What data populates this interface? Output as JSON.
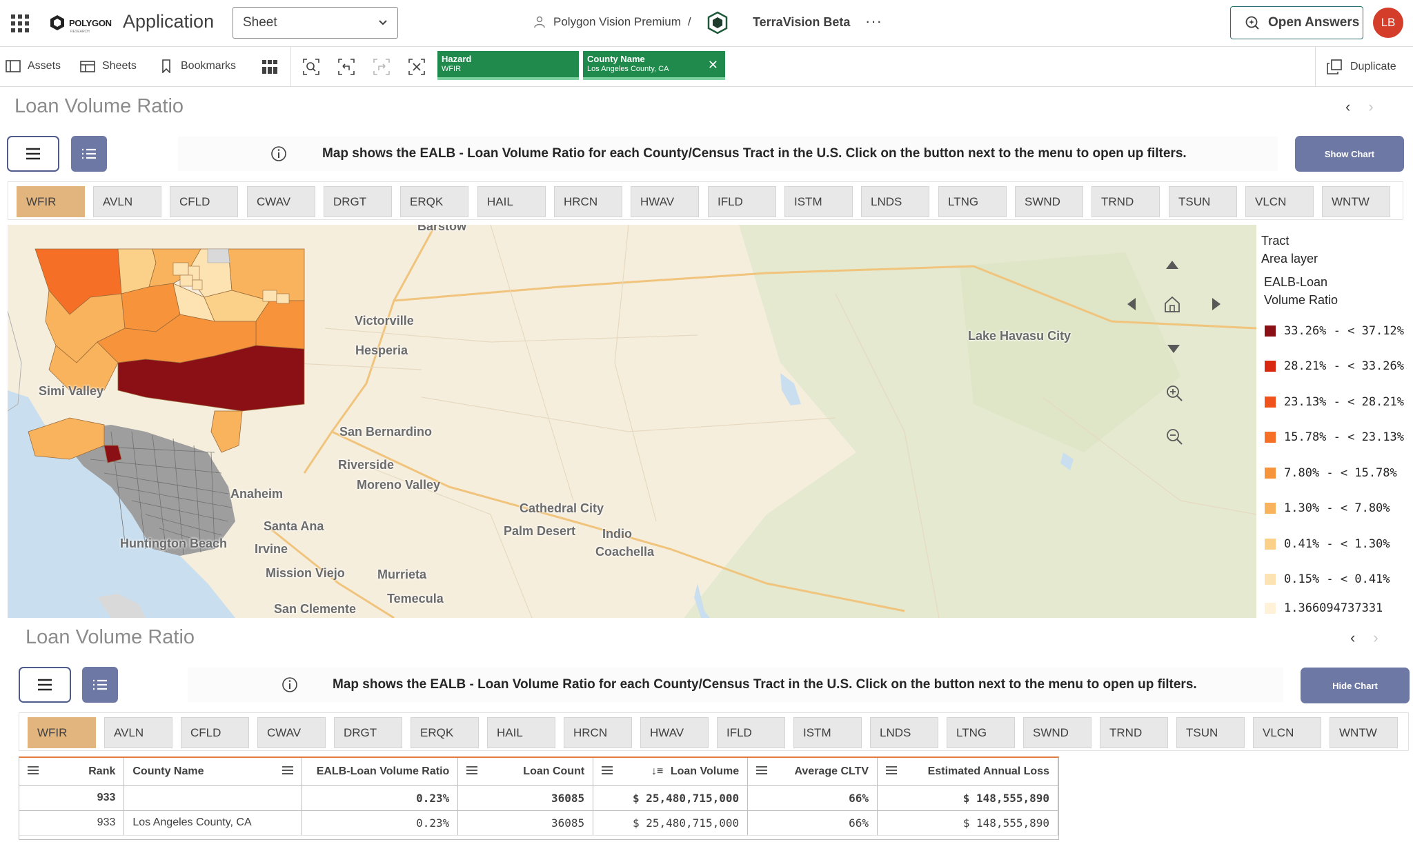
{
  "topbar": {
    "logo_text": "POLYGON",
    "logo_sub": "RESEARCH",
    "app_title": "Application",
    "sheet_select": "Sheet",
    "breadcrumb_space": "Polygon Vision Premium",
    "breadcrumb_sep": "/",
    "app_name": "TerraVision Beta",
    "more_label": "···",
    "open_answers": "Open Answers",
    "avatar_initials": "LB"
  },
  "toolbar": {
    "assets": "Assets",
    "sheets": "Sheets",
    "bookmarks": "Bookmarks",
    "filters": [
      {
        "title": "Hazard",
        "value": "WFIR"
      },
      {
        "title": "County Name",
        "value": "Los Angeles County, CA"
      }
    ],
    "duplicate": "Duplicate"
  },
  "top_sheet": {
    "title": "Loan Volume Ratio",
    "info": "Map shows the EALB - Loan Volume Ratio for each County/Census Tract in the U.S. Click on the button next to the menu to open up filters.",
    "chart_button": "Show Chart"
  },
  "bottom_sheet": {
    "title": "Loan Volume Ratio",
    "info": "Map shows the EALB - Loan Volume Ratio for each County/Census Tract in the U.S. Click on the button next to the menu to open up filters.",
    "chart_button": "Hide Chart"
  },
  "hazards": [
    "WFIR",
    "AVLN",
    "CFLD",
    "CWAV",
    "DRGT",
    "ERQK",
    "HAIL",
    "HRCN",
    "HWAV",
    "IFLD",
    "ISTM",
    "LNDS",
    "LTNG",
    "SWND",
    "TRND",
    "TSUN",
    "VLCN",
    "WNTW"
  ],
  "active_hazard": "WFIR",
  "map": {
    "places": [
      "Barstow",
      "Victorville",
      "Hesperia",
      "Lake Havasu City",
      "Simi Valley",
      "San Bernardino",
      "Riverside",
      "Moreno Valley",
      "Anaheim",
      "Santa Ana",
      "Huntington Beach",
      "Irvine",
      "Mission Viejo",
      "Murrieta",
      "Temecula",
      "San Clemente",
      "Cathedral City",
      "Palm Desert",
      "Indio",
      "Coachella"
    ],
    "colors": {
      "water": "#c9dff0",
      "land": "#f6eedd",
      "desert": "#e3e8cf",
      "road": "#f0c47c"
    }
  },
  "legend": {
    "layer_title_1": "Tract",
    "layer_title_2": "Area layer",
    "measure_1": "EALB-Loan",
    "measure_2": "Volume Ratio",
    "items": [
      {
        "label": "33.26% - < 37.12%",
        "color": "#8b1016"
      },
      {
        "label": "28.21% - < 33.26%",
        "color": "#d8280f"
      },
      {
        "label": "23.13% - < 28.21%",
        "color": "#f0521c"
      },
      {
        "label": "15.78% - < 23.13%",
        "color": "#f66f26"
      },
      {
        "label": "7.80% - < 15.78%",
        "color": "#f7933b"
      },
      {
        "label": "1.30% - < 7.80%",
        "color": "#f9b35c"
      },
      {
        "label": "0.41% - < 1.30%",
        "color": "#fbd089"
      },
      {
        "label": "0.15% - < 0.41%",
        "color": "#fde3b2"
      },
      {
        "label": "1.366094737331",
        "color": "#fff2d9"
      }
    ]
  },
  "table": {
    "columns": [
      "Rank",
      "County Name",
      "EALB-Loan Volume Ratio",
      "Loan Count",
      "Loan Volume",
      "Average CLTV",
      "Estimated Annual Loss"
    ],
    "sort_icon": "↓≡",
    "total": [
      "933",
      "",
      "0.23%",
      "36085",
      "$ 25,480,715,000",
      "66%",
      "$ 148,555,890"
    ],
    "rows": [
      [
        "933",
        "Los Angeles County, CA",
        "0.23%",
        "36085",
        "$ 25,480,715,000",
        "66%",
        "$ 148,555,890"
      ]
    ]
  }
}
